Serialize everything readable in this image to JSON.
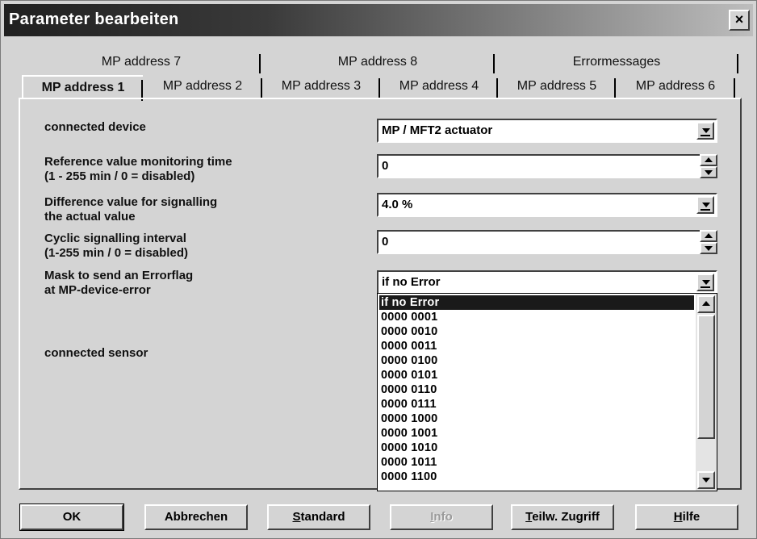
{
  "window": {
    "title": "Parameter bearbeiten",
    "close_glyph": "×"
  },
  "tabs": {
    "row_back": [
      "MP address 7",
      "MP address 8",
      "Errormessages"
    ],
    "row_front": [
      "MP address 1",
      "MP address 2",
      "MP address 3",
      "MP address 4",
      "MP address 5",
      "MP address 6"
    ],
    "active": "MP address 1"
  },
  "params": {
    "connected_device": {
      "label": "connected device",
      "value": "MP / MFT2 actuator"
    },
    "ref_monitoring": {
      "label_line1": "Reference value monitoring time",
      "label_line2": "(1 - 255 min / 0 = disabled)",
      "value": "0"
    },
    "diff_value": {
      "label_line1": "Difference value for signalling",
      "label_line2": "the actual value",
      "value": "4.0 %"
    },
    "cyclic": {
      "label_line1": "Cyclic signalling interval",
      "label_line2": "(1-255 min / 0 = disabled)",
      "value": "0"
    },
    "mask": {
      "label_line1": "Mask to send an Errorflag",
      "label_line2": "at MP-device-error",
      "value": "if no Error"
    },
    "connected_sensor": {
      "label": "connected sensor"
    }
  },
  "mask_options": [
    "if no Error",
    "0000 0001",
    "0000 0010",
    "0000 0011",
    "0000 0100",
    "0000 0101",
    "0000 0110",
    "0000 0111",
    "0000 1000",
    "0000 1001",
    "0000 1010",
    "0000 1011",
    "0000 1100"
  ],
  "mask_selected_index": 0,
  "buttons": {
    "ok": "OK",
    "cancel": "Abbrechen",
    "standard_u": "S",
    "standard_rest": "tandard",
    "info_u": "I",
    "info_rest": "nfo",
    "partial_u": "T",
    "partial_rest": "eilw. Zugriff",
    "help_u": "H",
    "help_rest": "ilfe"
  },
  "colors": {
    "selection": "#1a1a1a",
    "face": "#d4d4d4",
    "title_start": "#202020",
    "title_end": "#bdbdbd"
  }
}
